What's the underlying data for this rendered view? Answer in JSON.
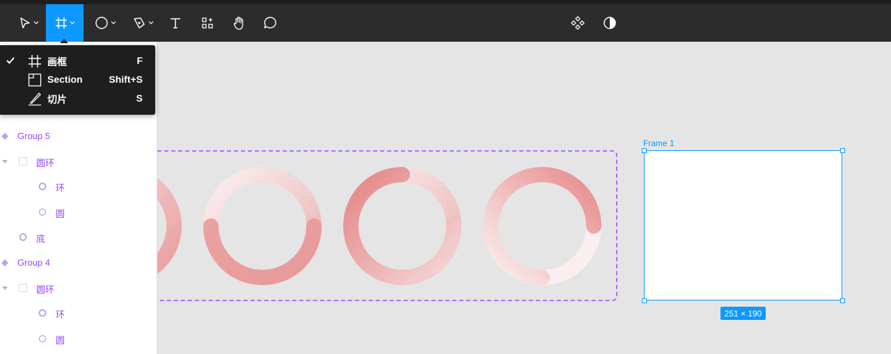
{
  "toolbar": {
    "tools": [
      {
        "name": "move-tool",
        "icon": "cursor-arrow-icon",
        "has_dropdown": true
      },
      {
        "name": "frame-tool",
        "icon": "hash-frame-icon",
        "has_dropdown": true,
        "active": true
      },
      {
        "name": "shape-tool",
        "icon": "circle-icon",
        "has_dropdown": true
      },
      {
        "name": "pen-tool",
        "icon": "pen-nib-icon",
        "has_dropdown": true
      },
      {
        "name": "text-tool",
        "icon": "text-t-icon",
        "has_dropdown": false
      },
      {
        "name": "resources-tool",
        "icon": "components-grid-icon",
        "has_dropdown": false
      },
      {
        "name": "hand-tool",
        "icon": "hand-icon",
        "has_dropdown": false
      },
      {
        "name": "comment-tool",
        "icon": "speech-bubble-icon",
        "has_dropdown": false
      }
    ],
    "center_icons": [
      "component-diamond-icon",
      "contrast-half-circle-icon"
    ],
    "accent_color": "#0d99ff"
  },
  "frame_menu": {
    "items": [
      {
        "label": "画框",
        "shortcut": "F",
        "checked": true,
        "icon": "hash-frame-icon"
      },
      {
        "label": "Section",
        "shortcut": "Shift+S",
        "checked": false,
        "icon": "section-icon"
      },
      {
        "label": "切片",
        "shortcut": "S",
        "checked": false,
        "icon": "slice-knife-icon"
      }
    ]
  },
  "layers": {
    "items": [
      {
        "label": "Group 5",
        "type": "component-instance",
        "icon": "diamond-icon"
      },
      {
        "label": "圆环",
        "type": "frame",
        "icon": "dotted-frame-icon",
        "expanded": true
      },
      {
        "label": "环",
        "type": "ellipse",
        "icon": "ellipse-icon"
      },
      {
        "label": "圆",
        "type": "ellipse",
        "icon": "ellipse-icon"
      },
      {
        "label": "底",
        "type": "ellipse",
        "icon": "ellipse-icon"
      },
      {
        "label": "Group 4",
        "type": "component-instance",
        "icon": "diamond-icon"
      },
      {
        "label": "圆环",
        "type": "frame",
        "icon": "dotted-frame-icon",
        "expanded": true
      },
      {
        "label": "环",
        "type": "ellipse",
        "icon": "ellipse-icon"
      },
      {
        "label": "圆",
        "type": "ellipse",
        "icon": "ellipse-icon"
      }
    ],
    "label_color": "#9747ff"
  },
  "canvas": {
    "frame_title": "Frame 1",
    "frame_size": "251 × 190",
    "component_border_color": "#9747ff",
    "ring_color": "#e58a8a"
  }
}
